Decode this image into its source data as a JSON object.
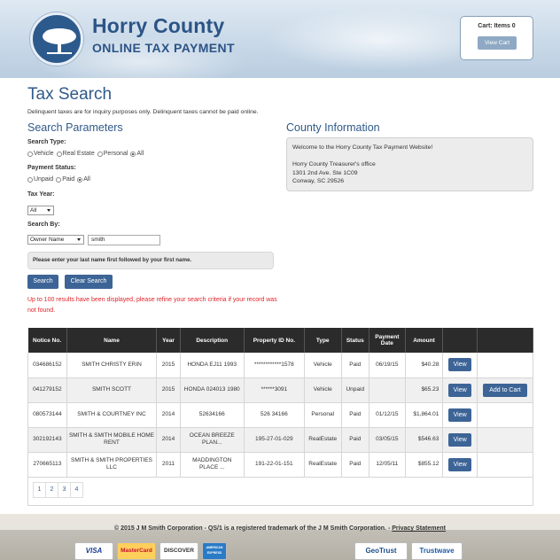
{
  "header": {
    "title": "Horry County",
    "subtitle": "ONLINE TAX PAYMENT",
    "cart_label": "Cart: Items 0",
    "view_cart": "View Cart"
  },
  "page": {
    "title": "Tax Search",
    "notice": "Delinquent taxes are for inquiry purposes only. Delinquent taxes cannot be paid online."
  },
  "search": {
    "heading": "Search Parameters",
    "search_type_label": "Search Type:",
    "search_type_options": [
      "Vehicle",
      "Real Estate",
      "Personal",
      "All"
    ],
    "search_type_selected": "All",
    "payment_status_label": "Payment Status:",
    "payment_status_options": [
      "Unpaid",
      "Paid",
      "All"
    ],
    "payment_status_selected": "All",
    "tax_year_label": "Tax Year:",
    "tax_year_value": "All",
    "search_by_label": "Search By:",
    "search_by_value": "Owner Name",
    "search_value": "smith",
    "hint": "Please enter your last name first followed by your first name.",
    "search_btn": "Search",
    "clear_btn": "Clear Search",
    "warning": "Up to 100 results have been displayed, please refine your search criteria if your record was not found."
  },
  "county": {
    "heading": "County Information",
    "welcome": "Welcome to the Horry County Tax Payment Website!",
    "office": "Horry County Treasurer's office",
    "address1": "1301 2nd Ave. Ste 1C09",
    "address2": "Conway, SC 29526"
  },
  "table": {
    "headers": [
      "Notice No.",
      "Name",
      "Year",
      "Description",
      "Property ID No.",
      "Type",
      "Status",
      "Payment Date",
      "Amount",
      "",
      ""
    ],
    "view_label": "View",
    "add_label": "Add to Cart",
    "rows": [
      {
        "notice": "034686152",
        "name": "SMITH CHRISTY ERIN",
        "year": "2015",
        "description": "HONDA EJ11 1993",
        "property_id": "************1578",
        "type": "Vehicle",
        "status": "Paid",
        "date": "06/19/15",
        "amount": "$40.28",
        "addable": false
      },
      {
        "notice": "041279152",
        "name": "SMITH SCOTT",
        "year": "2015",
        "description": "HONDA 024013 1980",
        "property_id": "******3091",
        "type": "Vehicle",
        "status": "Unpaid",
        "date": "",
        "amount": "$65.23",
        "addable": true
      },
      {
        "notice": "080573144",
        "name": "SMITH & COURTNEY INC",
        "year": "2014",
        "description": "52634166",
        "property_id": "526 34166",
        "type": "Personal",
        "status": "Paid",
        "date": "01/12/15",
        "amount": "$1,864.01",
        "addable": false
      },
      {
        "notice": "302192143",
        "name": "SMITH & SMITH MOBILE HOME RENT",
        "year": "2014",
        "description": "OCEAN BREEZE PLAN...",
        "property_id": "195-27-01-029",
        "type": "RealEstate",
        "status": "Paid",
        "date": "03/05/15",
        "amount": "$546.63",
        "addable": false
      },
      {
        "notice": "270665113",
        "name": "SMITH & SMITH PROPERTIES LLC",
        "year": "2011",
        "description": "MADDINGTON PLACE ...",
        "property_id": "191-22-01-151",
        "type": "RealEstate",
        "status": "Paid",
        "date": "12/05/11",
        "amount": "$855.12",
        "addable": false
      }
    ],
    "pages": [
      "1",
      "2",
      "3",
      "4"
    ]
  },
  "footer": {
    "copyright": "© 2015 J M Smith Corporation - QS/1 is a registered trademark of the J M Smith Corporation. -",
    "privacy": "Privacy Statement",
    "cards": [
      "VISA",
      "MasterCard",
      "DISCOVER",
      "AMERICAN EXPRESS"
    ],
    "seals": [
      "GeoTrust",
      "Trustwave"
    ]
  },
  "colors": {
    "brand_blue": "#2b5486",
    "button_blue": "#3d6496",
    "table_header": "#2b2b2b",
    "warning_red": "#e0242a"
  }
}
